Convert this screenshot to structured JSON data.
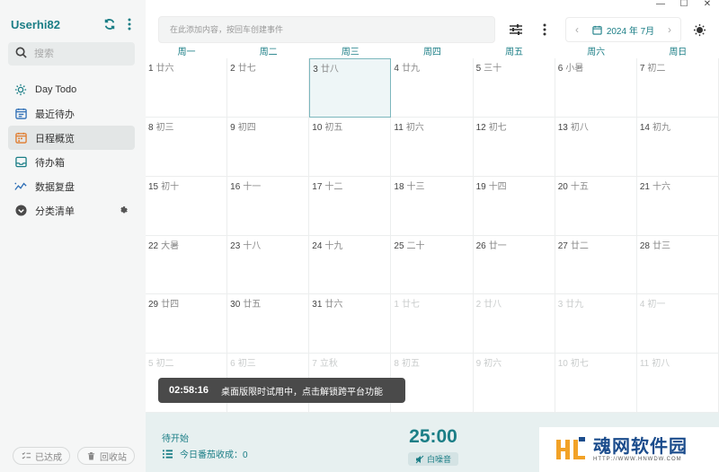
{
  "window": {
    "controls": [
      "—",
      "☐",
      "✕"
    ]
  },
  "sidebar": {
    "user": "Userhi82",
    "search_placeholder": "搜索",
    "items": [
      {
        "label": "Day Todo",
        "icon": "sun-icon"
      },
      {
        "label": "最近待办",
        "icon": "calendar-list-icon"
      },
      {
        "label": "日程概览",
        "icon": "calendar-grid-icon",
        "active": true
      },
      {
        "label": "待办箱",
        "icon": "inbox-icon"
      },
      {
        "label": "数据复盘",
        "icon": "chart-line-icon"
      },
      {
        "label": "分类清单",
        "icon": "chevron-circle-icon"
      }
    ],
    "footer": {
      "done_label": "已达成",
      "trash_label": "回收站"
    }
  },
  "topbar": {
    "add_placeholder": "在此添加内容，按回车创建事件",
    "month_label": "2024 年 7月"
  },
  "calendar": {
    "weekdays": [
      "周一",
      "周二",
      "周三",
      "周四",
      "周五",
      "周六",
      "周日"
    ],
    "weeks": [
      [
        {
          "d": "1",
          "l": "廿六"
        },
        {
          "d": "2",
          "l": "廿七"
        },
        {
          "d": "3",
          "l": "廿八",
          "today": true
        },
        {
          "d": "4",
          "l": "廿九"
        },
        {
          "d": "5",
          "l": "三十"
        },
        {
          "d": "6",
          "l": "小暑"
        },
        {
          "d": "7",
          "l": "初二"
        }
      ],
      [
        {
          "d": "8",
          "l": "初三"
        },
        {
          "d": "9",
          "l": "初四"
        },
        {
          "d": "10",
          "l": "初五"
        },
        {
          "d": "11",
          "l": "初六"
        },
        {
          "d": "12",
          "l": "初七"
        },
        {
          "d": "13",
          "l": "初八"
        },
        {
          "d": "14",
          "l": "初九"
        }
      ],
      [
        {
          "d": "15",
          "l": "初十"
        },
        {
          "d": "16",
          "l": "十一"
        },
        {
          "d": "17",
          "l": "十二"
        },
        {
          "d": "18",
          "l": "十三"
        },
        {
          "d": "19",
          "l": "十四"
        },
        {
          "d": "20",
          "l": "十五"
        },
        {
          "d": "21",
          "l": "十六"
        }
      ],
      [
        {
          "d": "22",
          "l": "大暑"
        },
        {
          "d": "23",
          "l": "十八"
        },
        {
          "d": "24",
          "l": "十九"
        },
        {
          "d": "25",
          "l": "二十"
        },
        {
          "d": "26",
          "l": "廿一"
        },
        {
          "d": "27",
          "l": "廿二"
        },
        {
          "d": "28",
          "l": "廿三"
        }
      ],
      [
        {
          "d": "29",
          "l": "廿四"
        },
        {
          "d": "30",
          "l": "廿五"
        },
        {
          "d": "31",
          "l": "廿六"
        },
        {
          "d": "1",
          "l": "廿七",
          "other": true
        },
        {
          "d": "2",
          "l": "廿八",
          "other": true
        },
        {
          "d": "3",
          "l": "廿九",
          "other": true
        },
        {
          "d": "4",
          "l": "初一",
          "other": true
        }
      ],
      [
        {
          "d": "5",
          "l": "初二",
          "other": true
        },
        {
          "d": "6",
          "l": "初三",
          "other": true
        },
        {
          "d": "7",
          "l": "立秋",
          "other": true
        },
        {
          "d": "8",
          "l": "初五",
          "other": true
        },
        {
          "d": "9",
          "l": "初六",
          "other": true
        },
        {
          "d": "10",
          "l": "初七",
          "other": true
        },
        {
          "d": "11",
          "l": "初八",
          "other": true
        }
      ]
    ]
  },
  "toast": {
    "time": "02:58:16",
    "message": "桌面版限时试用中，点击解锁跨平台功能"
  },
  "pomodoro": {
    "status": "待开始",
    "count_label": "今日番茄收成：0",
    "timer": "25:00",
    "noise_label": "白噪音"
  },
  "watermark": {
    "cn": "魂网软件园",
    "en": "HTTP://WWW.HNWDW.COM"
  },
  "colors": {
    "accent": "#1b7e86",
    "sidebar_bg": "#f5f6f6",
    "bottom_bg": "#e7f0f0",
    "today_bg": "#eef6f7"
  }
}
